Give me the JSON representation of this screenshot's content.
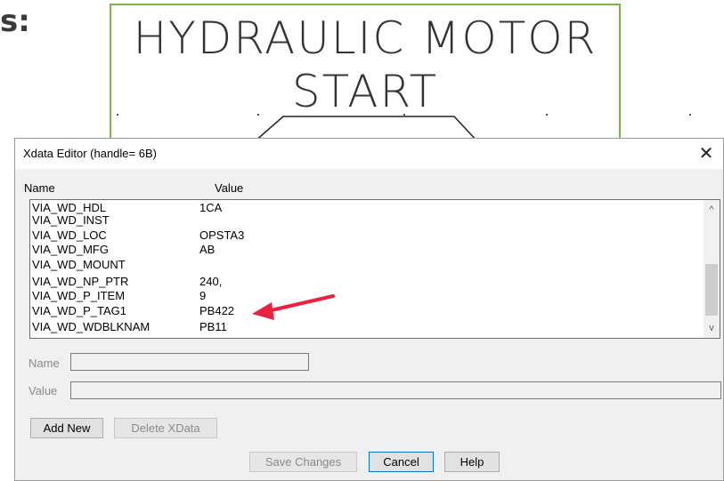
{
  "background": {
    "left_text": "s:",
    "drawing_title_line1": "HYDRAULIC MOTOR",
    "drawing_title_line2": "START"
  },
  "dialog": {
    "title": "Xdata Editor (handle= 6B)",
    "close_glyph": "✕",
    "columns": {
      "name": "Name",
      "value": "Value"
    },
    "rows": [
      {
        "name": "VIA_WD_HDL",
        "value": "1CA"
      },
      {
        "name": "VIA_WD_INST",
        "value": ""
      },
      {
        "name": "VIA_WD_LOC",
        "value": "OPSTA3"
      },
      {
        "name": "VIA_WD_MFG",
        "value": "AB"
      },
      {
        "name": "VIA_WD_MOUNT",
        "value": ""
      },
      {
        "name": "VIA_WD_NP_PTR",
        "value": "240,"
      },
      {
        "name": "VIA_WD_P_ITEM",
        "value": "9"
      },
      {
        "name": "VIA_WD_P_TAG1",
        "value": "PB422"
      },
      {
        "name": "VIA_WD_WDBLKNAM",
        "value": "PB11"
      }
    ],
    "scroll_up_glyph": "^",
    "scroll_down_glyph": "v",
    "name_field": {
      "label": "Name",
      "value": ""
    },
    "value_field": {
      "label": "Value",
      "value": ""
    },
    "buttons": {
      "add_new": "Add New",
      "delete_xdata": "Delete XData",
      "save_changes": "Save Changes",
      "cancel": "Cancel",
      "help": "Help"
    }
  },
  "colors": {
    "frame_green": "#7ab648",
    "annotation_arrow": "#e8223f",
    "focus_blue": "#0078d7"
  }
}
